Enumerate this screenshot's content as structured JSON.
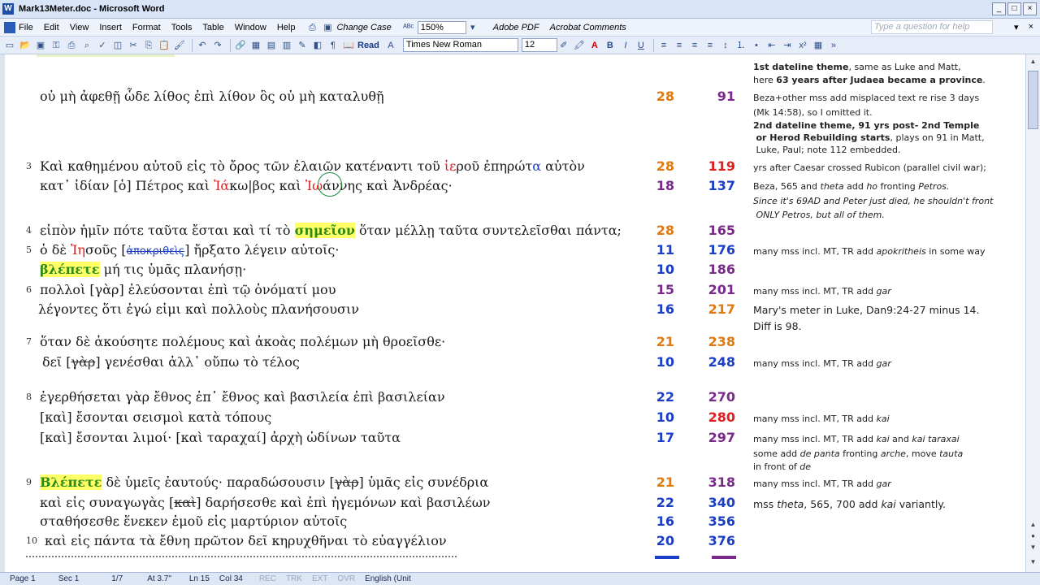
{
  "window": {
    "title": "Mark13Meter.doc - Microsoft Word",
    "buttons": [
      "_",
      "□",
      "×"
    ]
  },
  "menubar": {
    "items": [
      "File",
      "Edit",
      "View",
      "Insert",
      "Format",
      "Tools",
      "Table",
      "Window",
      "Help"
    ],
    "change_case": "Change Case",
    "zoom": "150%",
    "adobe_pdf": "Adobe PDF",
    "acrobat_comments": "Acrobat Comments",
    "help_placeholder": "Type a question for help"
  },
  "toolbar": {
    "read_label": "Read",
    "font_name": "Times New Roman",
    "font_size": "12"
  },
  "document": {
    "lines": [
      {
        "verse": "",
        "text": "οὐ μὴ ἀφεθῇ ὧδε λίθος ἐπὶ λίθον ὃς οὐ μὴ καταλυθῇ",
        "n1": "28",
        "n2": "91",
        "c1": "orange",
        "c2": "purple"
      },
      {
        "verse": "3",
        "text": "Καὶ καθημένου αὐτοῦ εἰς τὸ ὄρος τῶν ἐλαιῶν κατέναντι τοῦ ἱεροῦ ἐπηρώτα αὐτὸν",
        "n1": "28",
        "n2": "119",
        "c1": "orange",
        "c2": "red"
      },
      {
        "verse": "",
        "text": "κατ᾽ ἰδίαν [ὁ] Πέτρος καὶ Ἰάκωβος καὶ Ἰωάννης καὶ Ἀνδρέας·",
        "n1": "18",
        "n2": "137",
        "c1": "purple",
        "c2": "blue"
      },
      {
        "verse": "4",
        "text": "εἰπὸν ἡμῖν πότε ταῦτα ἔσται καὶ τί τὸ σημεῖον ὅταν μέλλῃ ταῦτα συντελεῖσθαι πάντα;",
        "n1": "28",
        "n2": "165",
        "c1": "orange",
        "c2": "purple"
      },
      {
        "verse": "5",
        "text": "ὁ δὲ Ἰησοῦς [ἀποκριθεὶς] ἤρξατο λέγειν αὐτοῖς·",
        "n1": "11",
        "n2": "176",
        "c1": "blue",
        "c2": "blue"
      },
      {
        "verse": "",
        "text": "βλέπετε μή τις ὑμᾶς πλανήσῃ·",
        "n1": "10",
        "n2": "186",
        "c1": "blue",
        "c2": "purple"
      },
      {
        "verse": "6",
        "text": "πολλοὶ [γὰρ] ἐλεύσονται ἐπὶ τῷ ὀνόματί μου",
        "n1": "15",
        "n2": "201",
        "c1": "purple",
        "c2": "purple"
      },
      {
        "verse": "",
        "text": "λέγοντες ὅτι ἐγώ εἰμι καὶ πολλοὺς πλανήσουσιν",
        "n1": "16",
        "n2": "217",
        "c1": "blue",
        "c2": "orange"
      },
      {
        "verse": "7",
        "text": "ὅταν δὲ ἀκούσητε πολέμους καὶ ἀκοὰς πολέμων μὴ θροεῖσθε·",
        "n1": "21",
        "n2": "238",
        "c1": "orange",
        "c2": "orange"
      },
      {
        "verse": "",
        "text": "δεῖ [γὰρ] γενέσθαι ἀλλ᾽ οὔπω τὸ τέλος",
        "n1": "10",
        "n2": "248",
        "c1": "blue",
        "c2": "blue"
      },
      {
        "verse": "8",
        "text": "ἐγερθήσεται γὰρ ἔθνος ἐπ᾽ ἔθνος καὶ βασιλεία ἐπὶ βασιλείαν",
        "n1": "22",
        "n2": "270",
        "c1": "blue",
        "c2": "purple"
      },
      {
        "verse": "",
        "text": "[καὶ] ἔσονται σεισμοὶ κατὰ τόπους",
        "n1": "10",
        "n2": "280",
        "c1": "blue",
        "c2": "red"
      },
      {
        "verse": "",
        "text": "[καὶ] ἔσονται λιμοί· [καὶ ταραχαί] ἀρχὴ ὠδίνων ταῦτα",
        "n1": "17",
        "n2": "297",
        "c1": "blue",
        "c2": "purple"
      },
      {
        "verse": "9",
        "text": "Βλέπετε δὲ ὑμεῖς ἑαυτούς· παραδώσουσιν [γὰρ] ὑμᾶς εἰς συνέδρια",
        "n1": "21",
        "n2": "318",
        "c1": "orange",
        "c2": "purple"
      },
      {
        "verse": "",
        "text": "καὶ εἰς συναγωγὰς [καὶ] δαρήσεσθε καὶ ἐπὶ ἡγεμόνων καὶ βασιλέων",
        "n1": "22",
        "n2": "340",
        "c1": "blue",
        "c2": "blue"
      },
      {
        "verse": "",
        "text": "σταθήσεσθε ἕνεκεν ἐμοῦ εἰς μαρτύριον αὐτοῖς",
        "n1": "16",
        "n2": "356",
        "c1": "blue",
        "c2": "blue"
      },
      {
        "verse": "10",
        "text": "καὶ εἰς πάντα τὰ ἔθνη πρῶτον δεῖ κηρυχθῆναι τὸ εὐαγγέλιον",
        "n1": "20",
        "n2": "376",
        "c1": "blue",
        "c2": "blue"
      }
    ],
    "notes": {
      "n1a": "1st dateline theme",
      "n1b": ", same as Luke and Matt,",
      "n1c": "here ",
      "n1d": "63 years after Judaea became a province",
      "n2a": "Beza+other mss add misplaced text re rise 3 days",
      "n2b": "(Mk 14:58), so I omitted it.",
      "n3a": "2nd dateline theme, 91 yrs post- 2nd Temple",
      "n3b": "or Herod Rebuilding starts",
      "n3c": ", plays on 91 in Matt,",
      "n3d": "Luke, Paul; note 112 embedded.",
      "n4": "yrs after Caesar crossed Rubicon (parallel civil war);",
      "n5a": "Beza, 565 and ",
      "n5b": "theta",
      "n5c": " add ",
      "n5d": "ho",
      "n5e": " fronting ",
      "n5f": "Petros.",
      "n6a": "Since it's 69AD and Peter just died, he shouldn't front",
      "n6b": "ONLY Petros, but all of them.",
      "n7a": "many mss incl. MT, TR add ",
      "n7b": "apokritheis",
      "n7c": " in some way",
      "n8a": "many mss incl. MT, TR add ",
      "n8b": "gar",
      "n9a": "Mary's meter in Luke, Dan9:24-27 minus 14.",
      "n9b": "Diff is 98.",
      "n10a": "many mss incl. MT, TR add ",
      "n10b": "gar",
      "n11a": "many mss incl. MT, TR add ",
      "n11b": "kai",
      "n12a": "many mss incl. MT, TR add ",
      "n12b": "kai",
      "n12c": " and ",
      "n12d": "kai taraxai",
      "n13a": "some add ",
      "n13b": "de panta",
      "n13c": " fronting ",
      "n13d": "arche",
      "n13e": ", move ",
      "n13f": "tauta",
      "n14a": "in front of ",
      "n14b": "de",
      "n15a": "many mss incl. MT, TR add ",
      "n15b": "gar",
      "n16a": "mss ",
      "n16b": "theta",
      "n16c": ", 565, 700 add ",
      "n16d": "kai",
      "n16e": " variantly."
    }
  },
  "statusbar": {
    "page": "Page 1",
    "sec": "Sec 1",
    "pages": "1/7",
    "at": "At 3.7\"",
    "ln": "Ln 15",
    "col": "Col 34",
    "rec": "REC",
    "trk": "TRK",
    "ext": "EXT",
    "ovr": "OVR",
    "lang": "English (Unit"
  },
  "colors": {
    "orange": "#e07a10",
    "purple": "#7a2a8a",
    "blue": "#1a3ec8",
    "red": "#e02020",
    "highlight": "#ffff66"
  }
}
